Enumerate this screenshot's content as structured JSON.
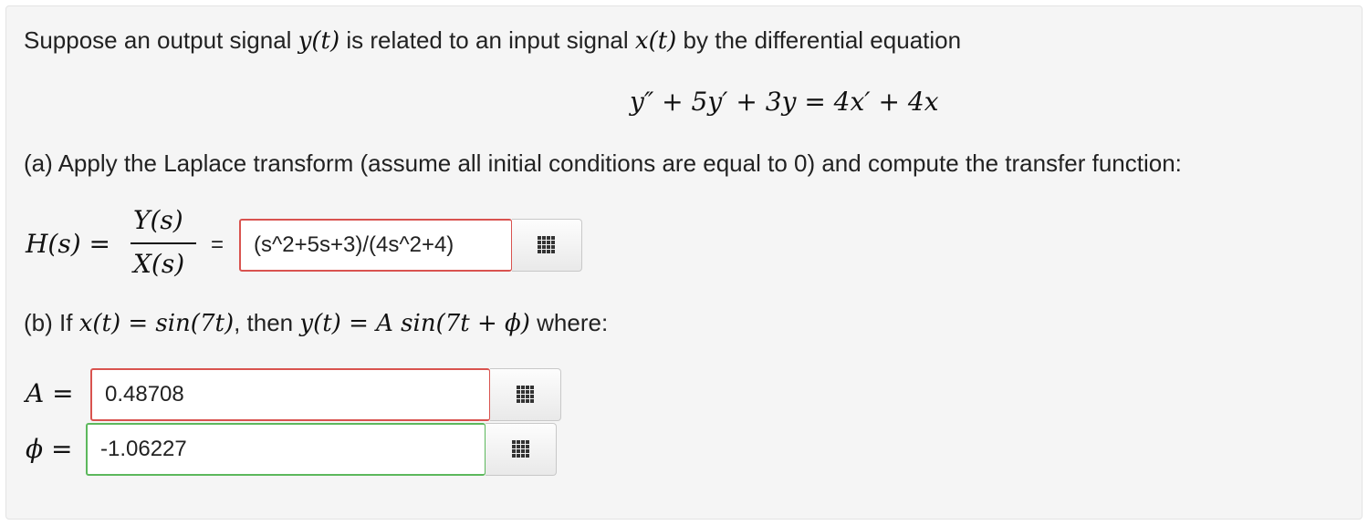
{
  "question": {
    "intro_text_1": "Suppose an output signal",
    "intro_text_2": "is related to an input signal",
    "intro_text_3": "by the differential equation",
    "y_of_t": "y(t)",
    "x_of_t": "x(t)",
    "equation": "y″ + 5y′ + 3y = 4x′ + 4x",
    "part_a_text": "(a) Apply the Laplace transform (assume all initial conditions are equal to 0) and compute the transfer function:",
    "part_b_prefix": "(b) If",
    "part_b_x_expr": "x(t) = sin(7t)",
    "part_b_then": ", then",
    "part_b_y_expr": "y(t) = A sin(7t + ϕ)",
    "part_b_suffix": "where:"
  },
  "transfer_function": {
    "lhs": "H(s) =",
    "numerator": "Y(s)",
    "denominator": "X(s)",
    "equals": "=",
    "answer_value": "(s^2+5s+3)/(4s^2+4)"
  },
  "amplitude": {
    "label": "A =",
    "value": "0.48708"
  },
  "phase": {
    "label": "ϕ =",
    "value": "-1.06227"
  },
  "icons": {
    "keyboard": "grid-keyboard-icon"
  },
  "colors": {
    "incorrect_border": "#d9534f",
    "correct_border": "#5cb85c",
    "panel_background": "#f5f5f5"
  }
}
